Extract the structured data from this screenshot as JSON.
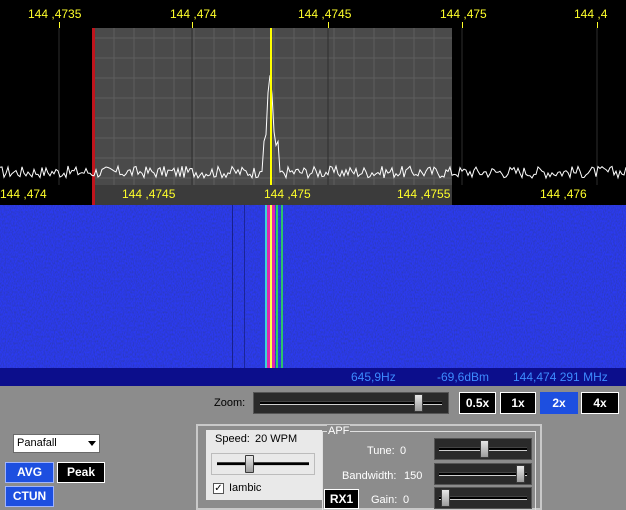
{
  "top_ruler": {
    "labels": [
      "144 ,4735",
      "144 ,474",
      "144 ,4745",
      "144 ,475",
      "144 ,4"
    ]
  },
  "mid_ruler": {
    "labels": [
      "144 ,474",
      "144 ,4745",
      "144 ,475",
      "144 ,4755",
      "144 ,476"
    ]
  },
  "status": {
    "offset": "645,9Hz",
    "level": "-69,6dBm",
    "frequency": "144,474 291 MHz"
  },
  "zoom": {
    "label": "Zoom:",
    "buttons": [
      "0.5x",
      "1x",
      "2x",
      "4x"
    ],
    "active": "2x",
    "level": 0.88
  },
  "display_mode": {
    "selected": "Panafall"
  },
  "buttons": {
    "avg": "AVG",
    "peak": "Peak",
    "ctun": "CTUN",
    "rx1": "RX1"
  },
  "cw": {
    "speed_label": "Speed:",
    "speed_value": "20 WPM",
    "speed_level": 0.33,
    "iambic_label": "Iambic",
    "iambic_checked": true
  },
  "apf": {
    "title": "APF",
    "tune_label": "Tune:",
    "tune_value": "0",
    "tune_level": 0.5,
    "bandwidth_label": "Bandwidth:",
    "bandwidth_value": "150",
    "bandwidth_level": 0.95,
    "gain_label": "Gain:",
    "gain_value": "0",
    "gain_level": 0.02
  },
  "colors": {
    "label_yellow": "#ffff2a",
    "filter_edge_red": "#c0141c",
    "carrier_yellow": "#ffff00",
    "waterfall_blue": "#1219a8",
    "accent_blue": "#1d4fe0",
    "status_text": "#3d8bff"
  }
}
